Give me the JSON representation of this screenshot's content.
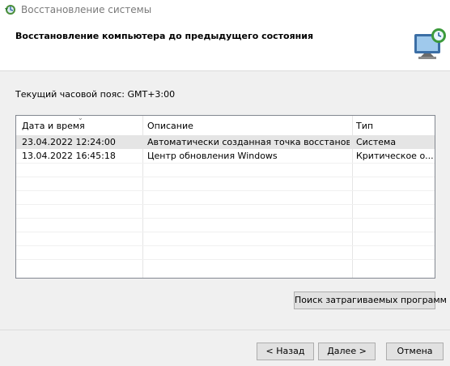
{
  "window": {
    "title": "Восстановление системы"
  },
  "header": {
    "title": "Восстановление компьютера до предыдущего состояния"
  },
  "timezone_label": "Текущий часовой пояс: GMT+3:00",
  "table": {
    "columns": [
      "Дата и время",
      "Описание",
      "Тип"
    ],
    "rows": [
      {
        "date": "23.04.2022 12:24:00",
        "description": "Автоматически созданная точка восстановле...",
        "type": "Система",
        "selected": true
      },
      {
        "date": "13.04.2022 16:45:18",
        "description": "Центр обновления Windows",
        "type": "Критическое о...",
        "selected": false
      }
    ]
  },
  "buttons": {
    "scan": "Поиск затрагиваемых программ",
    "back": "< Назад",
    "next": "Далее >",
    "cancel": "Отмена"
  },
  "icons": {
    "title": "system-restore-icon",
    "header": "system-restore-monitor-icon"
  },
  "colors": {
    "selected_row": "#e5e5e5",
    "table_border": "#828790",
    "button_bg": "#e1e1e1"
  }
}
